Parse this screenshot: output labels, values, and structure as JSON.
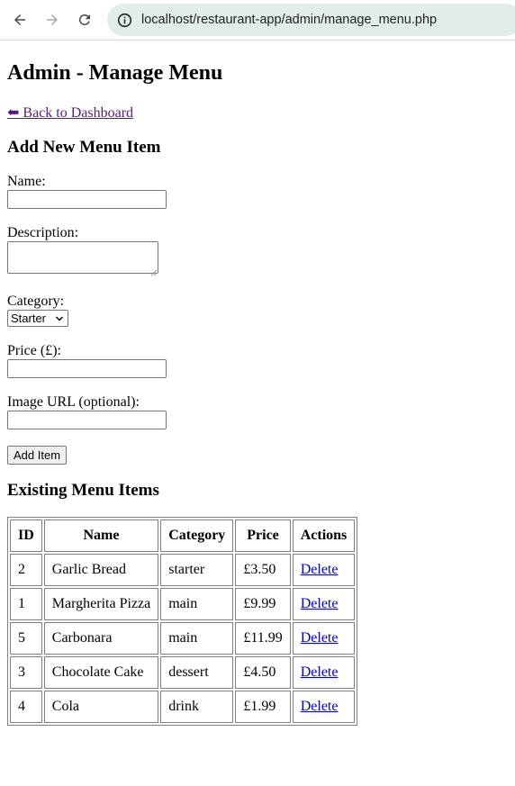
{
  "browser": {
    "url": "localhost/restaurant-app/admin/manage_menu.php"
  },
  "page": {
    "title": "Admin - Manage Menu",
    "back_link": "⬅ Back to Dashboard"
  },
  "add_form": {
    "heading": "Add New Menu Item",
    "name_label": "Name:",
    "description_label": "Description:",
    "category_label": "Category:",
    "category_selected": "Starter",
    "price_label": "Price (£):",
    "image_label": "Image URL (optional):",
    "submit_label": "Add Item"
  },
  "existing": {
    "heading": "Existing Menu Items",
    "columns": [
      "ID",
      "Name",
      "Category",
      "Price",
      "Actions"
    ],
    "rows": [
      {
        "id": "2",
        "name": "Garlic Bread",
        "category": "starter",
        "price": "£3.50",
        "action": "Delete"
      },
      {
        "id": "1",
        "name": "Margherita Pizza",
        "category": "main",
        "price": "£9.99",
        "action": "Delete"
      },
      {
        "id": "5",
        "name": "Carbonara",
        "category": "main",
        "price": "£11.99",
        "action": "Delete"
      },
      {
        "id": "3",
        "name": "Chocolate Cake",
        "category": "dessert",
        "price": "£4.50",
        "action": "Delete"
      },
      {
        "id": "4",
        "name": "Cola",
        "category": "drink",
        "price": "£1.99",
        "action": "Delete"
      }
    ]
  }
}
